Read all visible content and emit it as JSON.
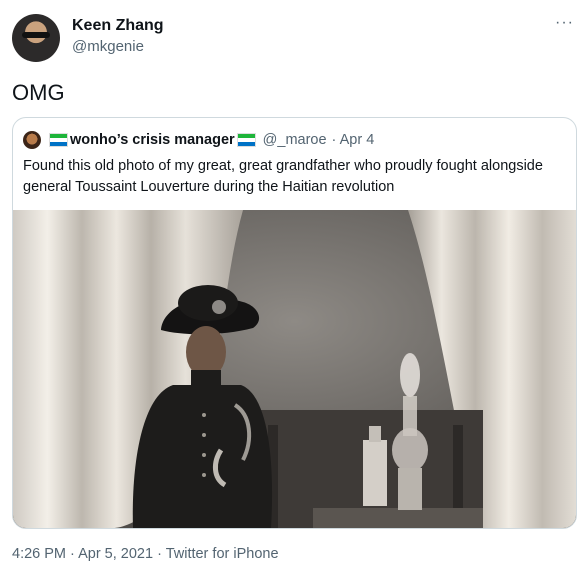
{
  "tweet": {
    "display_name": "Keen Zhang",
    "handle": "@mkgenie",
    "more_label": "···",
    "text": "OMG",
    "timestamp": "4:26 PM · Apr 5, 2021",
    "separator": " · ",
    "source": "Twitter for iPhone"
  },
  "quoted_tweet": {
    "display_name": "wonho’s crisis manager",
    "flag_icon": "sierra-leone-flag-icon",
    "handle": "@_maroe",
    "date": "· Apr 4",
    "text": "Found this old photo of my great, great grandfather who proudly fought alongside general Toussaint Louverture during the Haitian revolution"
  },
  "colors": {
    "secondary_text": "#536471",
    "border": "#cfd9de",
    "flag_green": "#1eb53a",
    "flag_blue": "#0072c6"
  }
}
